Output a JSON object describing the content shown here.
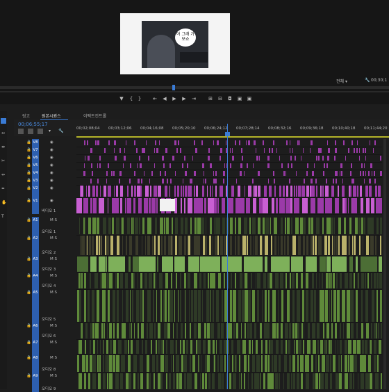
{
  "monitor": {
    "speech_text": "어 그래\n가보쇼",
    "zoom_label": "전체",
    "timecode_right": "00;30;1"
  },
  "tabs": [
    {
      "label": "링고"
    },
    {
      "label": "원본시퀀스",
      "active": true
    },
    {
      "label": "이펙트컨트롤"
    }
  ],
  "timeline": {
    "timecode": "00;06;55;17",
    "ruler": [
      "00;02;08;04",
      "00;03;12;06",
      "00;04;16;08",
      "00;05;20;10",
      "00;06;24;12",
      "00;07;28;14",
      "00;08;32;16",
      "00;09;36;18",
      "00;10;40;18",
      "00;11;44;20"
    ]
  },
  "video_tracks": [
    {
      "id": "V8",
      "label": "V8"
    },
    {
      "id": "V7",
      "label": "V7"
    },
    {
      "id": "V6",
      "label": "V6"
    },
    {
      "id": "V5",
      "label": "V5"
    },
    {
      "id": "V4",
      "label": "V4"
    },
    {
      "id": "V3",
      "label": "V3"
    },
    {
      "id": "V2",
      "label": "V2"
    },
    {
      "id": "V1",
      "label": "V1",
      "name": "비디오 1"
    }
  ],
  "audio_tracks": [
    {
      "id": "A1",
      "label": "A1",
      "name": "오디오 1"
    },
    {
      "id": "A2",
      "label": "A2",
      "name": "오디오 2"
    },
    {
      "id": "A3",
      "label": "A3",
      "name": "오디오 3"
    },
    {
      "id": "A4",
      "label": "A4",
      "name": "오디오 4"
    },
    {
      "id": "A5",
      "label": "A5",
      "name": "오디오 5"
    },
    {
      "id": "A6",
      "label": "A6",
      "name": "오디오 6"
    },
    {
      "id": "A7",
      "label": "A7",
      "name": ""
    },
    {
      "id": "A8",
      "label": "A8",
      "name": "오디오 8"
    },
    {
      "id": "A9",
      "label": "A9",
      "name": "오디오 9"
    }
  ],
  "colors": {
    "video_clip": "#9b3aa8",
    "audio_clip": "#5f8a3a",
    "audio_clip_yellow": "#b9b16a",
    "playhead": "#3a7bd5"
  }
}
